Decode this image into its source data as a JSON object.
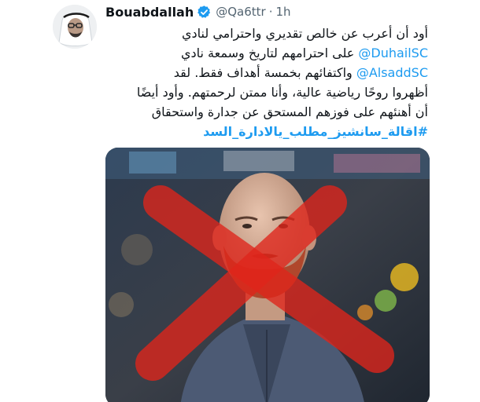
{
  "tweet": {
    "author": {
      "display_name": "Bouabdallah",
      "handle": "@Qa6ttr",
      "verified": true,
      "avatar_icon": "user-avatar"
    },
    "separator": "·",
    "timestamp": "1h",
    "text_lines": [
      {
        "parts": [
          {
            "type": "text",
            "text": "أود أن أعرب عن خالص تقديري واحترامي لنادي"
          }
        ]
      },
      {
        "parts": [
          {
            "type": "mention",
            "text": "@DuhailSC"
          },
          {
            "type": "text",
            "text": " على احترامهم لتاريخ وسمعة نادي"
          }
        ]
      },
      {
        "parts": [
          {
            "type": "mention",
            "text": "@AlsaddSC"
          },
          {
            "type": "text",
            "text": " واكتفائهم بخمسة أهداف فقط. لقد"
          }
        ]
      },
      {
        "parts": [
          {
            "type": "text",
            "text": "أظهروا روحًا رياضية عالية، وأنا ممتن لرحمتهم. وأود أيضًا"
          }
        ]
      },
      {
        "parts": [
          {
            "type": "text",
            "text": "أن أهنئهم على فوزهم المستحق عن جدارة واستحقاق"
          }
        ]
      },
      {
        "parts": [
          {
            "type": "hashtag",
            "text": "#اقالة_سانشيز_مطلب_يالادارة_السد"
          }
        ]
      }
    ],
    "media": {
      "icon": "coach-photo-crossed-out",
      "overlay_color": "#e0251b"
    }
  },
  "colors": {
    "accent": "#1d9bf0",
    "text": "#0f1419",
    "secondary_text": "#536471"
  }
}
